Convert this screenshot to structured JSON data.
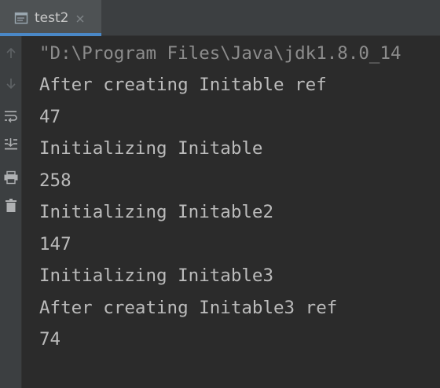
{
  "tab": {
    "label": "test2",
    "icon": "console-icon",
    "close_icon": "close-icon"
  },
  "toolbar": {
    "items": [
      {
        "icon": "arrow-up-icon"
      },
      {
        "icon": "arrow-down-icon"
      },
      {
        "icon": "soft-wrap-icon"
      },
      {
        "icon": "scroll-to-end-icon"
      },
      {
        "icon": "print-icon"
      },
      {
        "icon": "trash-icon"
      }
    ]
  },
  "console": {
    "lines": [
      "\"D:\\Program Files\\Java\\jdk1.8.0_14",
      "After creating Initable ref",
      "47",
      "Initializing Initable",
      "258",
      "Initializing Initable2",
      "147",
      "Initializing Initable3",
      "After creating Initable3 ref",
      "74"
    ]
  },
  "colors": {
    "background": "#2b2b2b",
    "panel": "#3c3f41",
    "tab_active": "#4e5254",
    "accent": "#4a88c7",
    "text": "#bbbbbb",
    "command_text": "#8c8c8c"
  }
}
